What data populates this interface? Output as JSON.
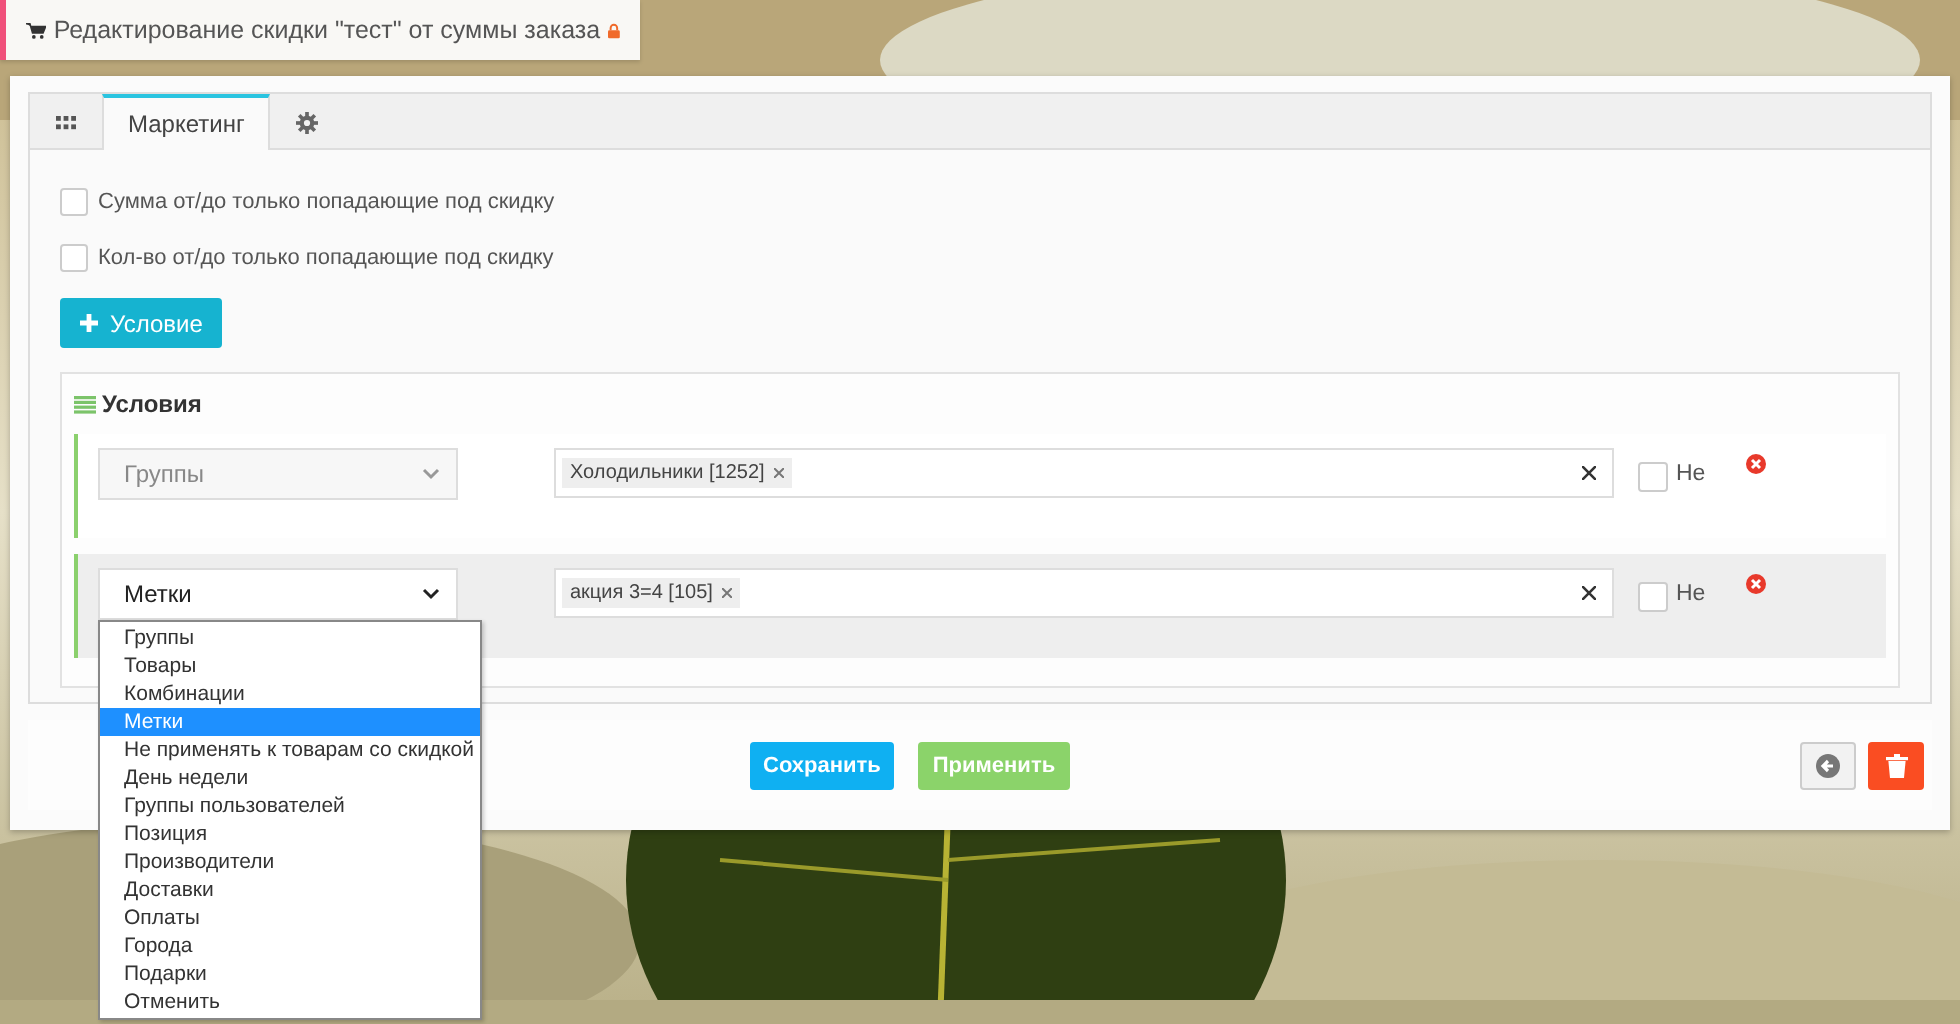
{
  "header": {
    "title": "Редактирование скидки \"тест\" от суммы заказа",
    "locked": true
  },
  "tabs": [
    {
      "kind": "grid",
      "selected": false
    },
    {
      "kind": "text",
      "label": "Маркетинг",
      "selected": true
    },
    {
      "kind": "gear",
      "selected": false
    }
  ],
  "options": [
    {
      "label": "Сумма от/до только попадающие под скидку",
      "checked": false
    },
    {
      "label": "Кол-во от/до только попадающие под скидку",
      "checked": false
    }
  ],
  "add_button": "Условие",
  "conditions": {
    "title": "Условия",
    "rows": [
      {
        "type": "Группы",
        "disabled": true,
        "active": false,
        "open": false,
        "tags": [
          "Холодильники [1252]"
        ],
        "negate_label": "Не",
        "negated": false
      },
      {
        "type": "Метки",
        "disabled": false,
        "active": true,
        "open": true,
        "tags": [
          "акция 3=4 [105]"
        ],
        "negate_label": "Не",
        "negated": false
      }
    ]
  },
  "dropdown": {
    "options": [
      {
        "label": "Группы",
        "selected": false
      },
      {
        "label": "Товары",
        "selected": false
      },
      {
        "label": "Комбинации",
        "selected": false
      },
      {
        "label": "Метки",
        "selected": true
      },
      {
        "label": "Не применять к товарам со скидкой",
        "selected": false
      },
      {
        "label": "День недели",
        "selected": false
      },
      {
        "label": "Группы пользователей",
        "selected": false
      },
      {
        "label": "Позиция",
        "selected": false
      },
      {
        "label": "Производители",
        "selected": false
      },
      {
        "label": "Доставки",
        "selected": false
      },
      {
        "label": "Оплаты",
        "selected": false
      },
      {
        "label": "Города",
        "selected": false
      },
      {
        "label": "Подарки",
        "selected": false
      },
      {
        "label": "Отменить",
        "selected": false
      }
    ]
  },
  "footer": {
    "save": "Сохранить",
    "apply": "Применить"
  }
}
